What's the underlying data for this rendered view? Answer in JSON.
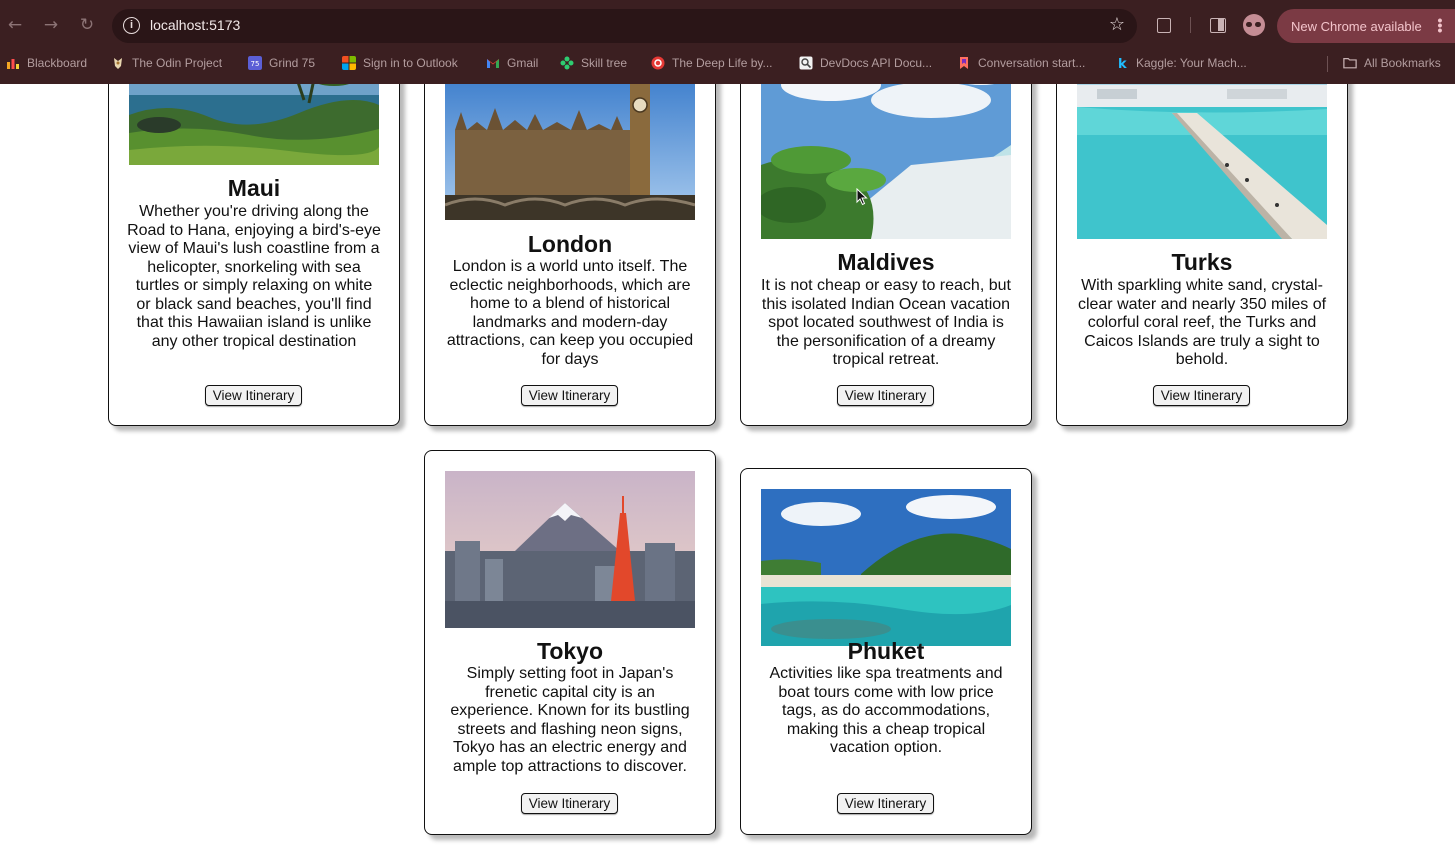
{
  "browser": {
    "url": "localhost:5173",
    "update_label": "New Chrome available",
    "bookmarks": [
      {
        "label": "Blackboard",
        "icon": "blackboard-icon",
        "color": "#f5a623"
      },
      {
        "label": "The Odin Project",
        "icon": "odin-project-icon",
        "color": "#e8d6b0"
      },
      {
        "label": "Grind 75",
        "icon": "grind75-icon",
        "color": "#5b5fd6"
      },
      {
        "label": "Sign in to Outlook",
        "icon": "microsoft-icon",
        "color": "#f25022"
      },
      {
        "label": "Gmail",
        "icon": "gmail-icon",
        "color": "#ea4335"
      },
      {
        "label": "Skill tree",
        "icon": "skill-tree-icon",
        "color": "#2ecc71"
      },
      {
        "label": "The Deep Life by...",
        "icon": "deep-life-icon",
        "color": "#e53935"
      },
      {
        "label": "DevDocs API Docu...",
        "icon": "devdocs-icon",
        "color": "#e0e0e0"
      },
      {
        "label": "Conversation start...",
        "icon": "conversation-icon",
        "color": "#ff6f61"
      },
      {
        "label": "Kaggle: Your Mach...",
        "icon": "kaggle-icon",
        "color": "#20beff"
      }
    ],
    "all_bookmarks": "All Bookmarks"
  },
  "page": {
    "button_label": "View Itinerary",
    "destinations": [
      {
        "title": "Maui",
        "image": "maui-coast-photo",
        "description": "Whether you're driving along the Road to Hana, enjoying a bird's-eye view of Maui's lush coastline from a helicopter, snorkeling with sea turtles or simply relaxing on white or black sand beaches, you'll find that this Hawaiian island is unlike any other tropical destination"
      },
      {
        "title": "London",
        "image": "london-parliament-photo",
        "description": "London is a world unto itself. The eclectic neighborhoods, which are home to a blend of historical landmarks and modern-day attractions, can keep you occupied for days"
      },
      {
        "title": "Maldives",
        "image": "maldives-beach-photo",
        "description": "It is not cheap or easy to reach, but this isolated Indian Ocean vacation spot located southwest of India is the personification of a dreamy tropical retreat."
      },
      {
        "title": "Turks",
        "image": "turks-pier-photo",
        "description": "With sparkling white sand, crystal-clear water and nearly 350 miles of colorful coral reef, the Turks and Caicos Islands are truly a sight to behold."
      },
      {
        "title": "Tokyo",
        "image": "tokyo-skyline-photo",
        "description": "Simply setting foot in Japan's frenetic capital city is an experience. Known for its bustling streets and flashing neon signs, Tokyo has an electric energy and ample top attractions to discover."
      },
      {
        "title": "Phuket",
        "image": "phuket-bay-photo",
        "description": "Activities like spa treatments and boat tours come with low price tags, as do accommodations, making this a cheap tropical vacation option."
      }
    ]
  }
}
